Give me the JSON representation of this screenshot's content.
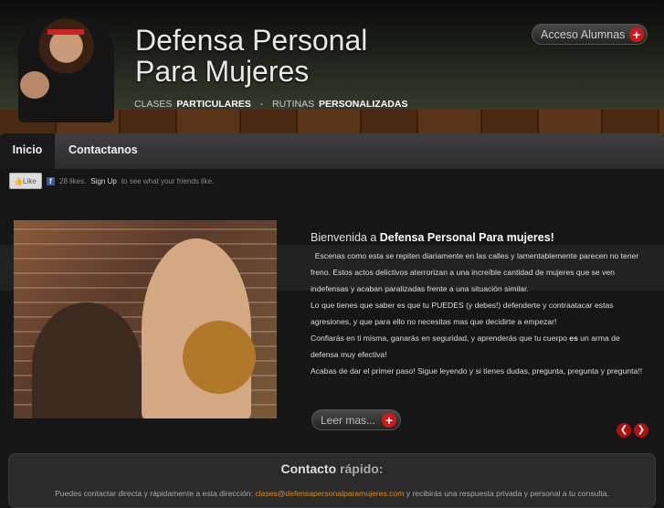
{
  "header": {
    "title_line1": "Defensa Personal",
    "title_line2": "Para Mujeres",
    "tagline": [
      "CLASES",
      "PARTICULARES",
      "-",
      "RUTINAS",
      "PERSONALIZADAS"
    ],
    "login_button": "Acceso Alumnas"
  },
  "nav": {
    "tabs": [
      {
        "label": "Inicio"
      },
      {
        "label": "Contactanos"
      }
    ]
  },
  "facebook": {
    "like_label": "Like",
    "likes": "28 likes.",
    "signup": "Sign Up",
    "suffix": "to see what your friends like."
  },
  "main": {
    "welcome_prefix": "Bienvenida a",
    "welcome_bold": "Defensa Personal Para mujeres!",
    "paragraphs": [
      "Escenas como esta se repiten diariamente en las calles y lamentablemente parecen no tener freno. Estos actos delictivos aterrorizan a una increíble cantidad de mujeres que se ven indefensas y acaban paralizadas frente a una situación similar.",
      "Lo que tienes que saber es que tu PUEDES (y debes!) defenderte y contraatacar estas agresiones, y que para ello no necesitas mas que decidirte a empezar!"
    ],
    "p3_a": "Confiarás en ti misma, ganarás en seguridad, y aprenderás que tu cuerpo",
    "p3_bold": "es",
    "p3_b": "un arma de defensa muy efectiva!",
    "p4": "Acabas de dar el primer paso! Sigue leyendo y si tienes dudas, pregunta, pregunta y pregunta!!",
    "read_more": "Leer mas..."
  },
  "contact": {
    "title_bold": "Contacto",
    "title_light": "rápido",
    "title_colon": ":",
    "text_before": "Puedes contactar directa y rápidamente a esta dirección:",
    "email": "clases@defensapersonalparamujeres.com",
    "text_after": "y recibirás una respuesta privada y personal a tu consulta."
  },
  "colors": {
    "accent": "#d01818",
    "link": "#e08a10"
  }
}
